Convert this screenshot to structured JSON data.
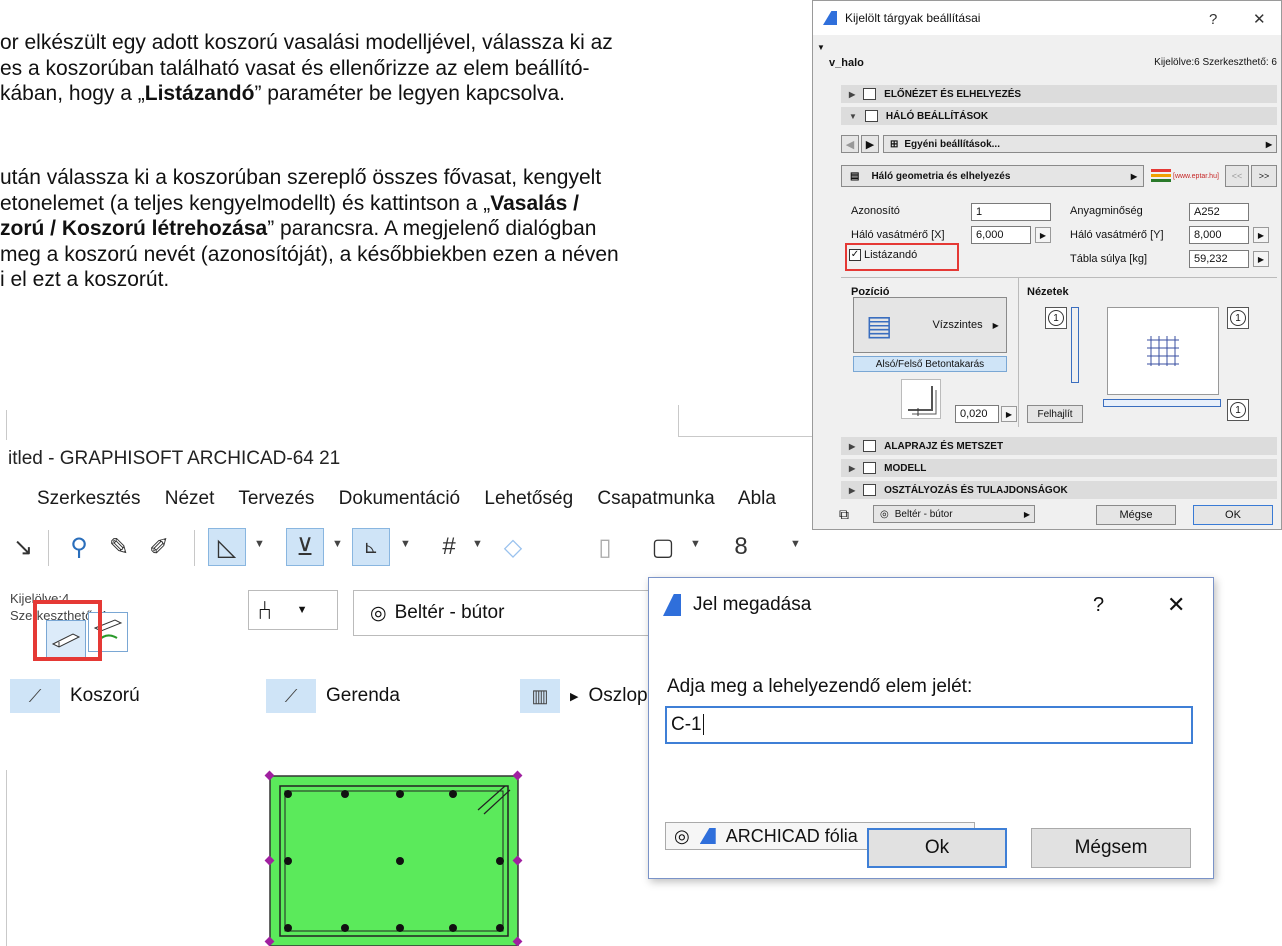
{
  "doc": {
    "para1": {
      "line1": "or elkészült egy adott koszorú vasalási modelljével, válassza ki az",
      "line2": "es a koszorúban található vasat és ellenőrizze az elem beállító-",
      "line3_pre": "kában, hogy a „",
      "line3_bold": "Listázandó",
      "line3_post": "” paraméter be legyen kapcsolva."
    },
    "para2": {
      "line1": "után válassza ki a koszorúban szereplő összes fővasat, kengyelt",
      "line2_pre": "etonelemet (a teljes kengyelmodellt) és kattintson a „",
      "line2_bold": "Vasalás /",
      "line3_bold": "zorú / Koszorú létrehozása",
      "line3_post": "” parancsra. A megjelenő dialógban",
      "line4": "meg a koszorú nevét (azonosítóját), a későbbiekben ezen a néven",
      "line5": "i el ezt a koszorút."
    }
  },
  "archicad": {
    "title": "itled - GRAPHISOFT ARCHICAD-64 21",
    "menu": [
      "Szerkesztés",
      "Nézet",
      "Tervezés",
      "Dokumentáció",
      "Lehetőség",
      "Csapatmunka",
      "Abla"
    ],
    "selection_info": {
      "line1": "Kijelölve:4",
      "line2": "Szerkeszthető: 4"
    },
    "layer": "Beltér - bútor",
    "tools": {
      "koszoru": "Koszorú",
      "gerenda": "Gerenda",
      "oszlop": "Oszlop"
    }
  },
  "settings_dialog": {
    "title": "Kijelölt tárgyak beállításai",
    "help": "?",
    "close": "✕",
    "object_name": "v_halo",
    "counts": "Kijelölve:6 Szerkeszthető: 6",
    "sections": {
      "elonezet": "ELŐNÉZET ÉS ELHELYEZÉS",
      "halo": "HÁLÓ BEÁLLÍTÁSOK",
      "alaprajz": "ALAPRAJZ ÉS METSZET",
      "modell": "MODELL",
      "osztalyozas": "OSZTÁLYOZÁS ÉS TULAJDONSÁGOK"
    },
    "custom_settings": "Egyéni beállítások...",
    "page_select": "Háló geometria és elhelyezés",
    "vendor_link": "[www.eptar.hu]",
    "nav_prev": "<<",
    "nav_next": ">>",
    "fields": {
      "azonosito_label": "Azonosító",
      "azonosito_value": "1",
      "anyag_label": "Anyagminőség",
      "anyag_value": "A252",
      "halo_x_label": "Háló vasátmérő [X]",
      "halo_x_value": "6,000",
      "halo_y_label": "Háló vasátmérő [Y]",
      "halo_y_value": "8,000",
      "listazando_label": "Listázandó",
      "tabla_label": "Tábla súlya [kg]",
      "tabla_value": "59,232"
    },
    "pozicio_label": "Pozíció",
    "pozicio_value": "Vízszintes",
    "also_felso": "Alsó/Felső Betontakarás",
    "cover_value": "0,020",
    "nezetek_label": "Nézetek",
    "felhajlit": "Felhajlít",
    "circle_num": "1",
    "footer_layer": "Beltér - bútor",
    "cancel": "Mégse",
    "ok": "OK"
  },
  "jel_dialog": {
    "title": "Jel megadása",
    "help": "?",
    "close": "✕",
    "prompt": "Adja meg a lehelyezendő elem jelét:",
    "input_value": "C-1",
    "layer": "ARCHICAD fólia",
    "ok": "Ok",
    "cancel": "Mégsem"
  },
  "colors": {
    "accent_red": "#e53935",
    "section_green": "#5bea5b",
    "rebar_purple": "#a020a0",
    "selection_blue": "#cfe4f7"
  }
}
